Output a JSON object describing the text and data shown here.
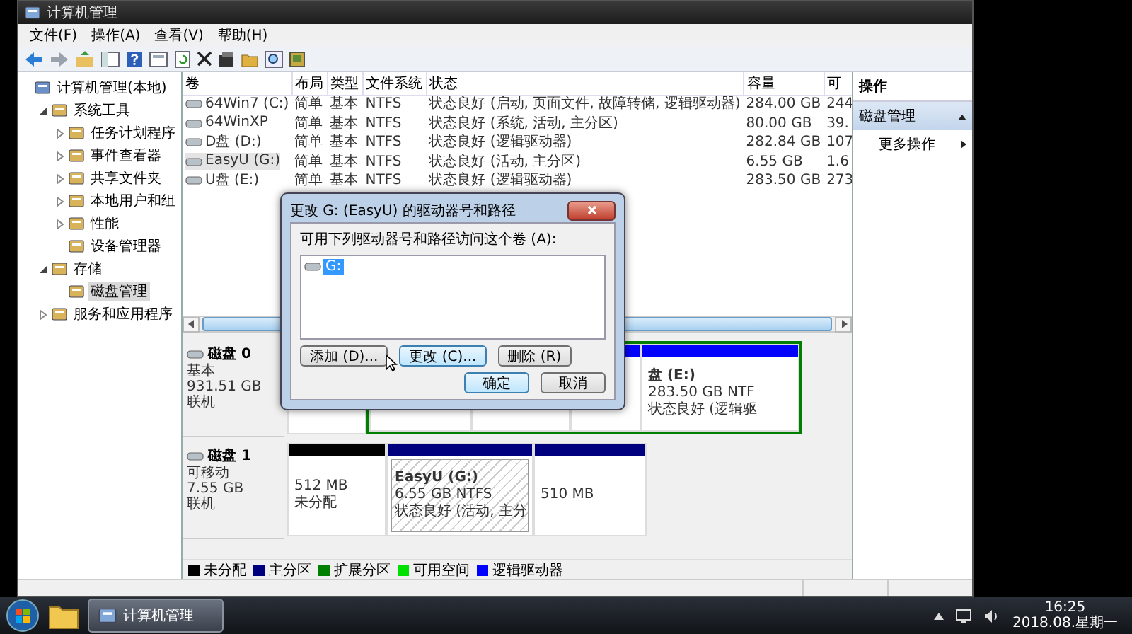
{
  "window": {
    "title": "计算机管理"
  },
  "menu": [
    "文件(F)",
    "操作(A)",
    "查看(V)",
    "帮助(H)"
  ],
  "tree": [
    {
      "label": "计算机管理(本地)",
      "selected": false,
      "children": [
        {
          "label": "系统工具",
          "selected": false,
          "expanded": true,
          "children": [
            {
              "label": "任务计划程序",
              "selected": false,
              "expanded": false
            },
            {
              "label": "事件查看器",
              "selected": false,
              "expanded": false
            },
            {
              "label": "共享文件夹",
              "selected": false,
              "expanded": false
            },
            {
              "label": "本地用户和组",
              "selected": false,
              "expanded": false
            },
            {
              "label": "性能",
              "selected": false,
              "expanded": false
            },
            {
              "label": "设备管理器",
              "selected": false
            }
          ]
        },
        {
          "label": "存储",
          "selected": false,
          "expanded": true,
          "children": [
            {
              "label": "磁盘管理",
              "selected": true
            }
          ]
        },
        {
          "label": "服务和应用程序",
          "selected": false,
          "expanded": false
        }
      ]
    }
  ],
  "table": {
    "columns": [
      "卷",
      "布局",
      "类型",
      "文件系统",
      "状态",
      "容量",
      "可"
    ],
    "rows": [
      {
        "selected": false,
        "cells": [
          "64Win7  (C:)",
          "简单",
          "基本",
          "NTFS",
          "状态良好 (启动, 页面文件, 故障转储, 逻辑驱动器)",
          "284.00 GB",
          "244"
        ]
      },
      {
        "selected": false,
        "cells": [
          "64WinXP",
          "简单",
          "基本",
          "NTFS",
          "状态良好 (系统, 活动, 主分区)",
          "80.00 GB",
          "39."
        ]
      },
      {
        "selected": false,
        "cells": [
          "D盘 (D:)",
          "简单",
          "基本",
          "NTFS",
          "状态良好 (逻辑驱动器)",
          "282.84 GB",
          "107"
        ]
      },
      {
        "selected": true,
        "cells": [
          "EasyU (G:)",
          "简单",
          "基本",
          "NTFS",
          "状态良好 (活动, 主分区)",
          "6.55 GB",
          "1.6"
        ]
      },
      {
        "selected": false,
        "cells": [
          "U盘 (E:)",
          "简单",
          "基本",
          "NTFS",
          "状态良好 (逻辑驱动器)",
          "283.50 GB",
          "273"
        ]
      }
    ]
  },
  "disks": [
    {
      "name": "磁盘 0",
      "type": "基本",
      "size": "931.51 GB",
      "status": "联机",
      "partitions": [
        {
          "kind": "primary"
        },
        {
          "kind": "extended",
          "children": [
            {
              "kind": "logical"
            },
            {
              "kind": "logical"
            },
            {
              "kind": "logical"
            },
            {
              "kind": "logical",
              "selected": false,
              "label": "盘 (E:)",
              "size": "283.50 GB NTF",
              "status": "状态良好 (逻辑驱"
            }
          ]
        }
      ]
    },
    {
      "name": "磁盘 1",
      "type": "可移动",
      "size": "7.55 GB",
      "status": "联机",
      "partitions": [
        {
          "kind": "unallocated",
          "selected": false,
          "size": "512 MB",
          "status": "未分配"
        },
        {
          "kind": "primary",
          "selected": true,
          "label": "EasyU  (G:)",
          "size": "6.55 GB NTFS",
          "status": "状态良好 (活动, 主分"
        },
        {
          "kind": "primary",
          "selected": false,
          "size": "510 MB"
        }
      ]
    }
  ],
  "legend": [
    {
      "label": "未分配",
      "color": "#000000"
    },
    {
      "label": "主分区",
      "color": "#00007f"
    },
    {
      "label": "扩展分区",
      "color": "#007f00"
    },
    {
      "label": "可用空间",
      "color": "#00e000"
    },
    {
      "label": "逻辑驱动器",
      "color": "#0000ff"
    }
  ],
  "actions": {
    "title": "操作",
    "section": {
      "label": "磁盘管理",
      "expanded": true
    },
    "items": [
      "更多操作"
    ]
  },
  "dialog": {
    "title": "更改 G: (EasyU) 的驱动器号和路径",
    "prompt": "可用下列驱动器号和路径访问这个卷 (A):",
    "entries": [
      {
        "label": "G:",
        "selected": true
      }
    ],
    "buttons": [
      {
        "label": "添加 (D)...",
        "hovered": false
      },
      {
        "label": "更改 (C)...",
        "hovered": true
      },
      {
        "label": "删除 (R)",
        "hovered": false
      }
    ],
    "ok": "确定",
    "cancel": "取消"
  },
  "taskbar": {
    "tasks": [
      {
        "label": "计算机管理",
        "active": true
      }
    ],
    "time": "16:25",
    "date": "2018.08.星期一"
  }
}
